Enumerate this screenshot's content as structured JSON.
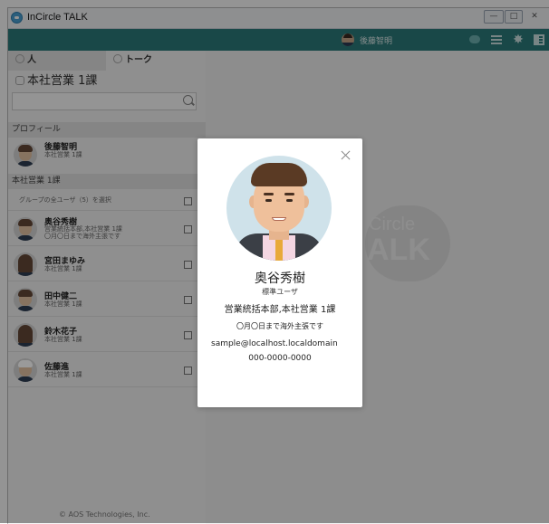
{
  "window": {
    "title": "InCircle TALK",
    "min_label": "—",
    "max_label": "□",
    "close_label": "✕"
  },
  "topbar": {
    "user_name": "後藤智明",
    "gear_glyph": "✸"
  },
  "sidebar": {
    "tabs": [
      {
        "label": "人"
      },
      {
        "label": "トーク"
      }
    ],
    "group_title": "本社営業 1課",
    "search_placeholder": "",
    "profile_section": "プロフィール",
    "profile": {
      "name": "後藤智明",
      "dept": "本社営業 1課"
    },
    "group_section": "本社営業 1課",
    "select_all_label": "グループの全ユーザ（5）を選択",
    "members": [
      {
        "name": "奥谷秀樹",
        "dept": "営業統括本部,本社営業 1課",
        "status": "〇月〇日まで海外主張です"
      },
      {
        "name": "宮田まゆみ",
        "dept": "本社営業 1課"
      },
      {
        "name": "田中健二",
        "dept": "本社営業 1課"
      },
      {
        "name": "鈴木花子",
        "dept": "本社営業 1課"
      },
      {
        "name": "佐藤進",
        "dept": "本社営業 1課"
      }
    ],
    "footer": "© AOS Technologies, Inc."
  },
  "main": {
    "watermark_line1": "Circle",
    "watermark_line2": "ALK"
  },
  "modal": {
    "name": "奥谷秀樹",
    "role": "標準ユーザ",
    "dept": "営業統括本部,本社営業 1課",
    "status": "〇月〇日まで海外主張です",
    "email": "sample@localhost.localdomain",
    "phone": "000-0000-0000"
  },
  "colors": {
    "topbar": "#2b7c7c",
    "overlay": "rgba(0,0,0,0.42)",
    "modal_bg": "#ffffff"
  }
}
